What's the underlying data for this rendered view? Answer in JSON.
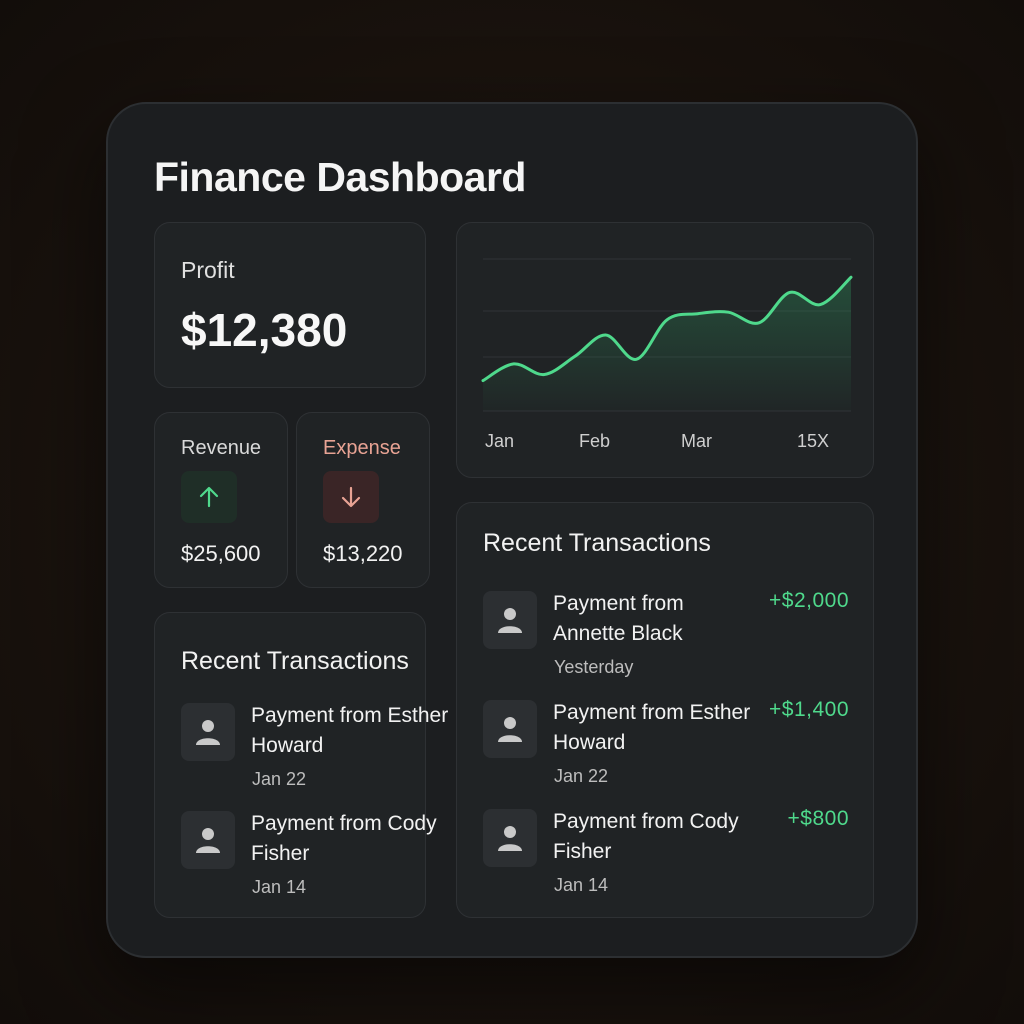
{
  "title": "Finance Dashboard",
  "profit": {
    "label": "Profit",
    "value": "$12,380"
  },
  "revenue": {
    "label": "Revenue",
    "amount": "$25,600",
    "icon": "arrow-up-icon",
    "color": "#4fd98c"
  },
  "expense": {
    "label": "Expense",
    "amount": "$13,220",
    "icon": "arrow-down-icon",
    "color": "#e8a394"
  },
  "chart_data": {
    "type": "area",
    "x_tick_labels": [
      "Jan",
      "Feb",
      "Mar",
      "15X"
    ],
    "values": [
      20,
      31,
      24,
      36,
      50,
      34,
      60,
      64,
      65,
      58,
      78,
      70,
      88
    ],
    "ylim": [
      0,
      100
    ],
    "color": "#4fd98c",
    "grid": true
  },
  "recent_small": {
    "title": "Recent Transactions",
    "items": [
      {
        "name": "Payment from Esther Howard",
        "date": "Jan 22"
      },
      {
        "name": "Payment from Cody Fisher",
        "date": "Jan 14"
      }
    ]
  },
  "recent_big": {
    "title": "Recent Transactions",
    "items": [
      {
        "name": "Payment from Annette Black",
        "date": "Yesterday",
        "amount": "+$2,000"
      },
      {
        "name": "Payment from Esther Howard",
        "date": "Jan 22",
        "amount": "+$1,400"
      },
      {
        "name": "Payment from Cody Fisher",
        "date": "Jan 14",
        "amount": "+$800"
      }
    ]
  }
}
